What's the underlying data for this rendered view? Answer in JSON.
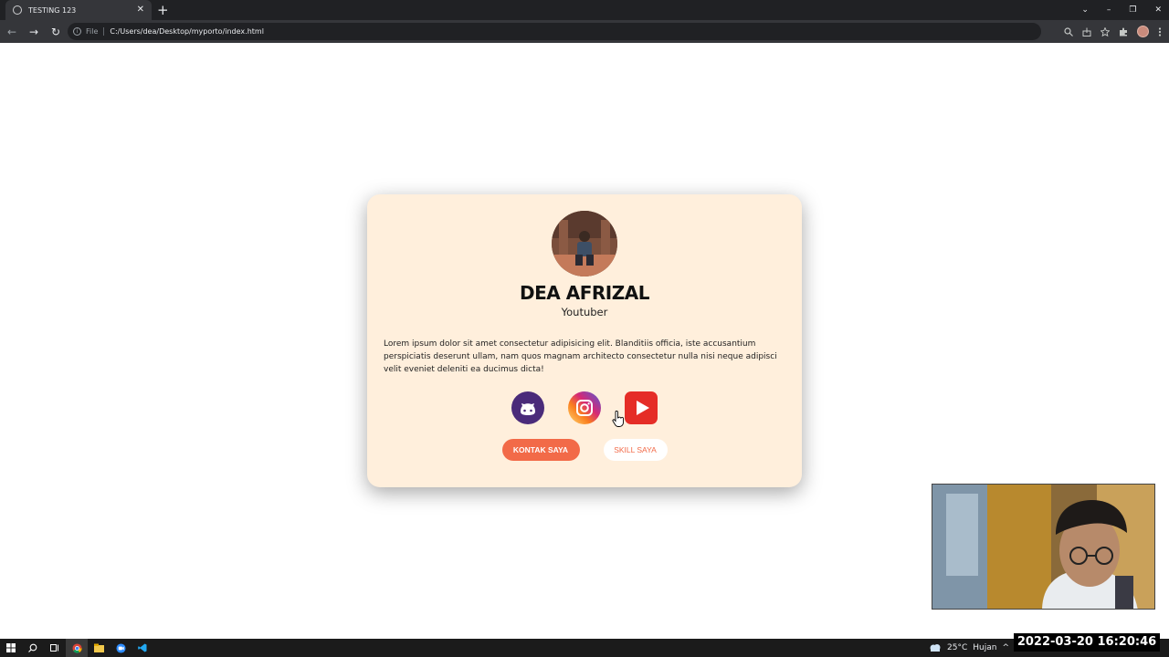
{
  "browser": {
    "tab_title": "TESTING 123",
    "tab_close": "✕",
    "new_tab": "+",
    "file_label": "File",
    "url": "C:/Users/dea/Desktop/myporto/index.html",
    "window_controls": {
      "chevron": "⌄",
      "minimize": "–",
      "restore": "❐",
      "close": "✕"
    }
  },
  "profile": {
    "name": "DEA AFRIZAL",
    "role": "Youtuber",
    "bio": "Lorem ipsum dolor sit amet consectetur adipisicing elit. Blanditiis officia, iste accusantium perspiciatis deserunt ullam, nam quos magnam architecto consectetur nulla nisi neque adipisci velit eveniet deleniti ea ducimus dicta!"
  },
  "socials": [
    {
      "name": "github",
      "icon": "github-icon",
      "color": "#4a2b7a"
    },
    {
      "name": "instagram",
      "icon": "instagram-icon",
      "color": "#d6249f"
    },
    {
      "name": "youtube",
      "icon": "youtube-icon",
      "color": "#e52d27"
    }
  ],
  "buttons": {
    "contact_label": "KONTAK SAYA",
    "skill_label": "SKILL SAYA"
  },
  "colors": {
    "card_bg": "#ffefdc",
    "accent": "#f26a48"
  },
  "taskbar": {
    "weather": "25°C",
    "weather_desc": "Hujan"
  },
  "timestamp": "2022-03-20 16:20:46"
}
